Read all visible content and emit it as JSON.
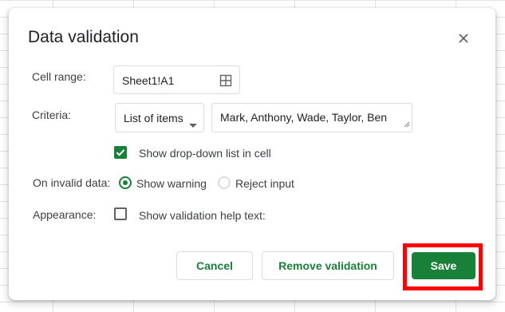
{
  "dialog": {
    "title": "Data validation",
    "close_icon": "close-icon"
  },
  "cell_range": {
    "label": "Cell range:",
    "value": "Sheet1!A1",
    "icon": "grid-select-icon"
  },
  "criteria": {
    "label": "Criteria:",
    "selected": "List of items",
    "items_value": "Mark, Anthony, Wade, Taylor, Ben",
    "show_dropdown_label": "Show drop-down list in cell",
    "show_dropdown_checked": true
  },
  "invalid_data": {
    "label": "On invalid data:",
    "option_warning": "Show warning",
    "option_reject": "Reject input",
    "selected": "Show warning"
  },
  "appearance": {
    "label": "Appearance:",
    "help_text_label": "Show validation help text:",
    "help_text_checked": false
  },
  "buttons": {
    "cancel": "Cancel",
    "remove": "Remove validation",
    "save": "Save"
  },
  "colors": {
    "accent": "#188038",
    "highlight": "#ff0000"
  }
}
